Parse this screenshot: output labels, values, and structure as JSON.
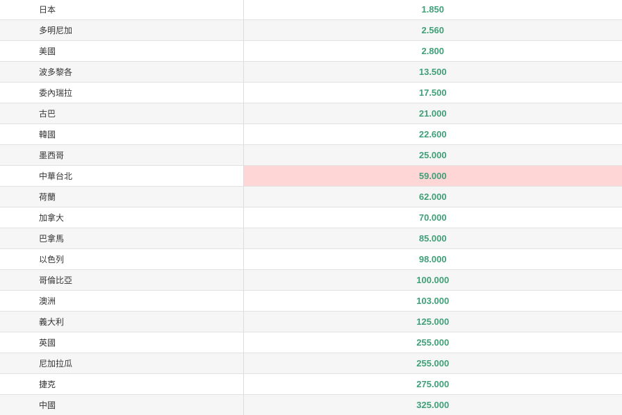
{
  "colors": {
    "odds_text": "#3f9f78",
    "highlight_bg": "#ffd6d6",
    "stripe_bg": "#f6f6f6"
  },
  "rows": [
    {
      "team": "日本",
      "odds": "1.850",
      "highlighted": false
    },
    {
      "team": "多明尼加",
      "odds": "2.560",
      "highlighted": false
    },
    {
      "team": "美國",
      "odds": "2.800",
      "highlighted": false
    },
    {
      "team": "波多黎各",
      "odds": "13.500",
      "highlighted": false
    },
    {
      "team": "委內瑞拉",
      "odds": "17.500",
      "highlighted": false
    },
    {
      "team": "古巴",
      "odds": "21.000",
      "highlighted": false
    },
    {
      "team": "韓國",
      "odds": "22.600",
      "highlighted": false
    },
    {
      "team": "墨西哥",
      "odds": "25.000",
      "highlighted": false
    },
    {
      "team": "中華台北",
      "odds": "59.000",
      "highlighted": true
    },
    {
      "team": "荷蘭",
      "odds": "62.000",
      "highlighted": false
    },
    {
      "team": "加拿大",
      "odds": "70.000",
      "highlighted": false
    },
    {
      "team": "巴拿馬",
      "odds": "85.000",
      "highlighted": false
    },
    {
      "team": "以色列",
      "odds": "98.000",
      "highlighted": false
    },
    {
      "team": "哥倫比亞",
      "odds": "100.000",
      "highlighted": false
    },
    {
      "team": "澳洲",
      "odds": "103.000",
      "highlighted": false
    },
    {
      "team": "義大利",
      "odds": "125.000",
      "highlighted": false
    },
    {
      "team": "英國",
      "odds": "255.000",
      "highlighted": false
    },
    {
      "team": "尼加拉瓜",
      "odds": "255.000",
      "highlighted": false
    },
    {
      "team": "捷克",
      "odds": "275.000",
      "highlighted": false
    },
    {
      "team": "中國",
      "odds": "325.000",
      "highlighted": false
    }
  ]
}
